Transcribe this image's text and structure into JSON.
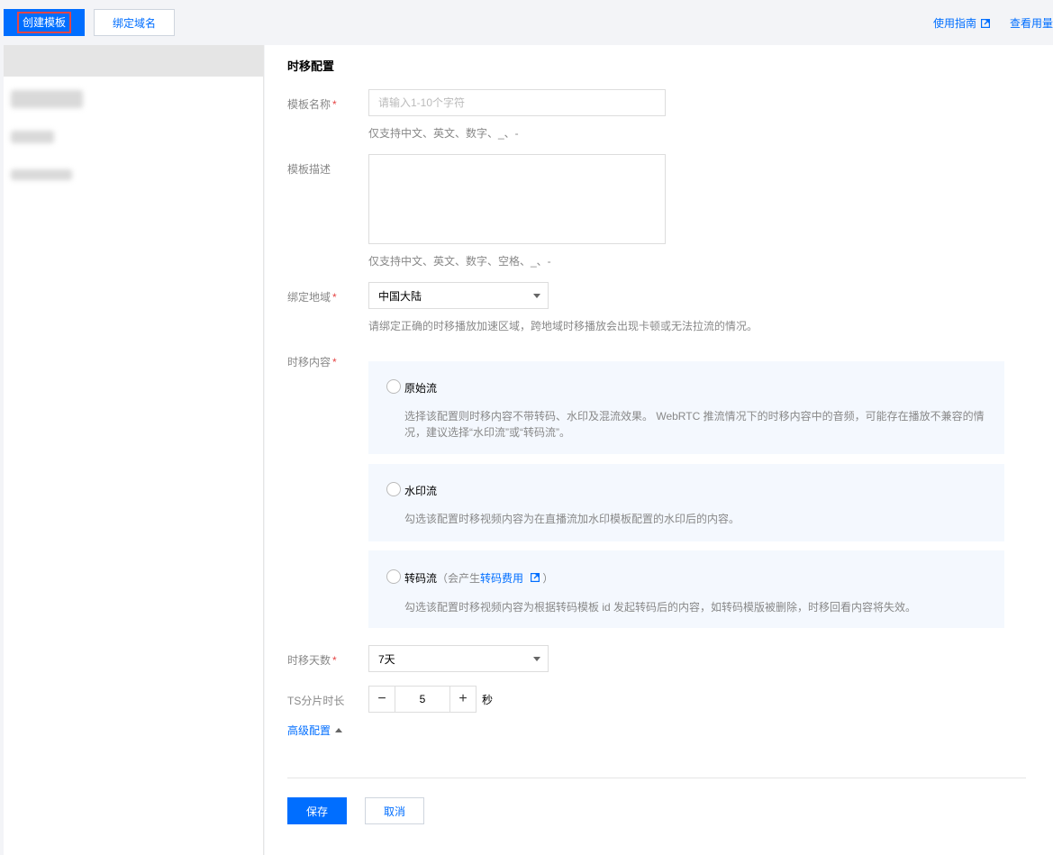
{
  "toolbar": {
    "create_template": "创建模板",
    "bind_domain": "绑定域名",
    "guide_link": "使用指南",
    "usage_link": "查看用量"
  },
  "form": {
    "section_title": "时移配置",
    "name": {
      "label": "模板名称",
      "placeholder": "请输入1-10个字符",
      "hint": "仅支持中文、英文、数字、_、-"
    },
    "description": {
      "label": "模板描述",
      "hint": "仅支持中文、英文、数字、空格、_、-"
    },
    "region": {
      "label": "绑定地域",
      "value": "中国大陆",
      "hint": "请绑定正确的时移播放加速区域，跨地域时移播放会出现卡顿或无法拉流的情况。"
    },
    "content": {
      "label": "时移内容",
      "options": [
        {
          "title": "原始流",
          "desc": "选择该配置则时移内容不带转码、水印及混流效果。 WebRTC 推流情况下的时移内容中的音频，可能存在播放不兼容的情况，建议选择“水印流”或“转码流”。"
        },
        {
          "title": "水印流",
          "desc": "勾选该配置时移视频内容为在直播流加水印模板配置的水印后的内容。"
        },
        {
          "title": "转码流",
          "sub_prefix": "（会产生",
          "link": "转码费用",
          "sub_suffix": "）",
          "desc": "勾选该配置时移视频内容为根据转码模板 id 发起转码后的内容，如转码模版被删除，时移回看内容将失效。"
        }
      ]
    },
    "days": {
      "label": "时移天数",
      "value": "7天"
    },
    "ts": {
      "label": "TS分片时长",
      "value": "5",
      "unit": "秒",
      "minus": "−",
      "plus": "+"
    },
    "advanced": "高级配置",
    "required_mark": "*",
    "save": "保存",
    "cancel": "取消"
  },
  "colors": {
    "primary": "#006eff",
    "required": "#e54545",
    "option_bg": "#f4f8fe"
  }
}
